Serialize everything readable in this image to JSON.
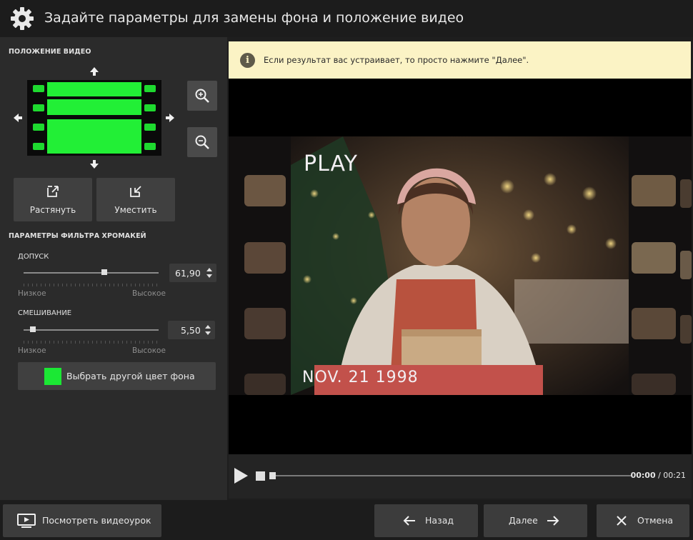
{
  "window": {
    "title": "Задайте параметры для замены фона и положение видео",
    "icon": "gear-icon"
  },
  "video_position": {
    "section_title": "ПОЛОЖЕНИЕ ВИДЕО",
    "stretch_label": "Растянуть",
    "fit_label": "Уместить",
    "zoom_in_icon": "zoom-in-icon",
    "zoom_out_icon": "zoom-out-icon"
  },
  "chromakey": {
    "section_title": "ПАРАМЕТРЫ ФИЛЬТРА ХРОМАКЕЙ",
    "tolerance": {
      "label": "ДОПУСК",
      "value": "61,90",
      "fraction": 0.6,
      "low_label": "Низкое",
      "high_label": "Высокое"
    },
    "blending": {
      "label": "СМЕШИВАНИЕ",
      "value": "5,50",
      "fraction": 0.07,
      "low_label": "Низкое",
      "high_label": "Высокое"
    },
    "color_button_label": "Выбрать другой цвет фона",
    "key_color": "#1be834"
  },
  "notice": {
    "text": "Если результат вас устраивает, то просто нажмите \"Далее\"."
  },
  "preview": {
    "overlay_top": "PLAY",
    "overlay_bottom": "NOV. 21 1998"
  },
  "player": {
    "current_time": "00:00",
    "separator": " / ",
    "total_time": "00:21",
    "progress": 0.0
  },
  "footer": {
    "tutorial_label": "Посмотреть видеоурок",
    "back_label": "Назад",
    "next_label": "Далее",
    "cancel_label": "Отмена"
  }
}
